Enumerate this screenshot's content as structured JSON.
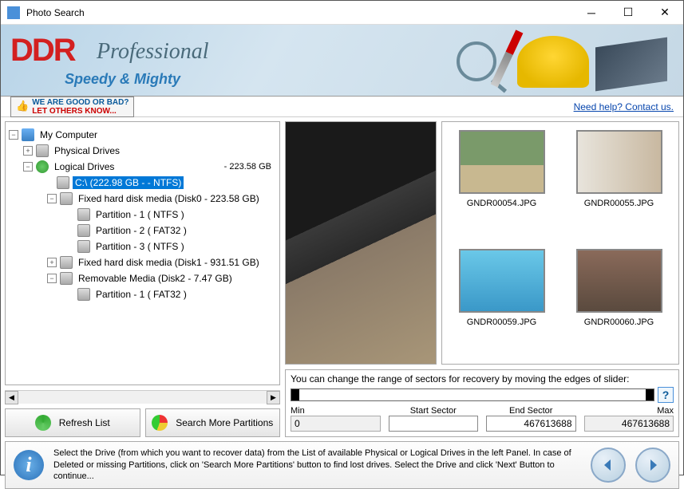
{
  "window": {
    "title": "Photo Search"
  },
  "banner": {
    "brand": "DDR",
    "product": "Professional",
    "tagline": "Speedy & Mighty"
  },
  "topstrip": {
    "feedback_line1": "WE ARE GOOD OR BAD?",
    "feedback_line2": "LET OTHERS KNOW...",
    "help_link": "Need help? Contact us."
  },
  "tree": {
    "root": "My Computer",
    "physical": "Physical Drives",
    "logical": "Logical Drives",
    "logical_size": "- 223.58 GB",
    "selected": "C:\\ (222.98 GB - - NTFS)",
    "disk0": "Fixed hard disk media (Disk0 - 223.58 GB)",
    "d0p1": "Partition - 1 ( NTFS )",
    "d0p2": "Partition - 2 ( FAT32 )",
    "d0p3": "Partition - 3 ( NTFS )",
    "disk1": "Fixed hard disk media (Disk1 - 931.51 GB)",
    "disk2": "Removable Media  (Disk2 - 7.47 GB)",
    "d2p1": "Partition - 1 ( FAT32 )"
  },
  "buttons": {
    "refresh": "Refresh List",
    "search_more": "Search More Partitions"
  },
  "thumbs": [
    {
      "name": "GNDR00054.JPG"
    },
    {
      "name": "GNDR00055.JPG"
    },
    {
      "name": "GNDR00059.JPG"
    },
    {
      "name": "GNDR00060.JPG"
    }
  ],
  "sector": {
    "hint": "You can change the range of sectors for recovery by moving the edges of slider:",
    "min_label": "Min",
    "start_label": "Start Sector",
    "end_label": "End Sector",
    "max_label": "Max",
    "min_value": "0",
    "end_value": "467613688",
    "max_value": "467613688"
  },
  "info": {
    "text": "Select the Drive (from which you want to recover data) from the List of available Physical or Logical Drives in the left Panel. In case of Deleted or missing Partitions, click on 'Search More Partitions' button to find lost drives. Select the Drive and click 'Next' Button to continue..."
  }
}
